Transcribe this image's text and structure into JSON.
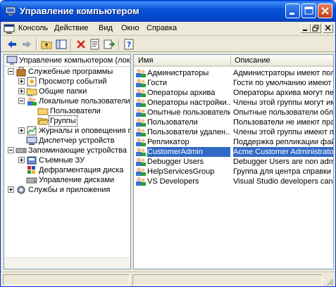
{
  "window": {
    "title": "Управление компьютером"
  },
  "menu": {
    "items": [
      "Консоль",
      "Действие",
      "Вид",
      "Окно",
      "Справка"
    ]
  },
  "tree": {
    "root": "Управление компьютером (локаль",
    "items": [
      {
        "label": "Служебные программы"
      },
      {
        "label": "Просмотр событий"
      },
      {
        "label": "Общие папки"
      },
      {
        "label": "Локальные пользователи и"
      },
      {
        "label": "Пользователи"
      },
      {
        "label": "Группы"
      },
      {
        "label": "Журналы и оповещения пр"
      },
      {
        "label": "Диспетчер устройств"
      },
      {
        "label": "Запоминающие устройства"
      },
      {
        "label": "Съемные ЗУ"
      },
      {
        "label": "Дефрагментация диска"
      },
      {
        "label": "Управление дисками"
      },
      {
        "label": "Службы и приложения"
      }
    ]
  },
  "list": {
    "columns": [
      "Имя",
      "Описание"
    ],
    "rows": [
      {
        "name": "Администраторы",
        "desc": "Администраторы имеют полны"
      },
      {
        "name": "Гости",
        "desc": "Гости по умолчанию имеют то"
      },
      {
        "name": "Операторы архива",
        "desc": "Операторы архива могут перес"
      },
      {
        "name": "Операторы настройки...",
        "desc": "Члены этой группы могут имет"
      },
      {
        "name": "Опытные пользователи",
        "desc": "Опытные пользователи облад"
      },
      {
        "name": "Пользователи",
        "desc": "Пользователи не имеют прав н"
      },
      {
        "name": "Пользователи удален...",
        "desc": "Члены этой группы имеют прав"
      },
      {
        "name": "Репликатор",
        "desc": "Поддержка репликации файло"
      },
      {
        "name": "CustomerAdmin",
        "desc": "Acme Customer Administrator"
      },
      {
        "name": "Debugger Users",
        "desc": "Debugger Users are non administ"
      },
      {
        "name": "HelpServicesGroup",
        "desc": "Группа для центра справки и"
      },
      {
        "name": "VS Developers",
        "desc": "Visual Studio developers can auth"
      }
    ]
  },
  "colors": {
    "title_bar": "#0856d8",
    "selection": "#316ac5",
    "window_bg": "#ece9d8"
  }
}
